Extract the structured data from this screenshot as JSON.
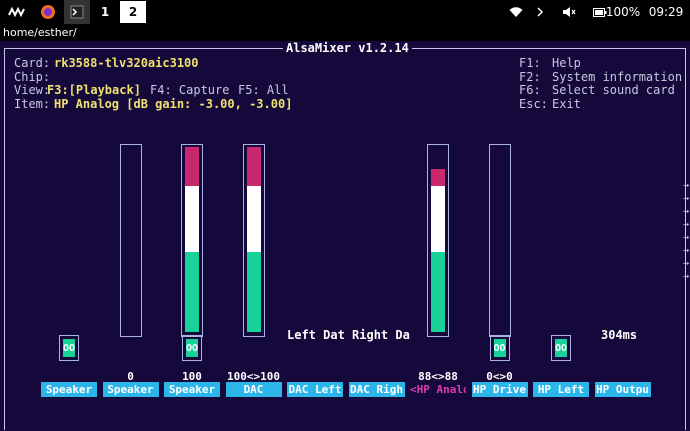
{
  "topbar": {
    "workspaces": [
      "1",
      "2"
    ],
    "battery": "100%",
    "clock": "09:29"
  },
  "path": "home/esther/",
  "mixer": {
    "title": "AlsaMixer v1.2.14",
    "card_label": "Card:",
    "card_value": "rk3588-tlv320aic3100",
    "chip_label": "Chip:",
    "view_label": "View:",
    "view_f3": "F3:[Playback]",
    "view_f4": "F4: Capture",
    "view_f5": "F5: All",
    "item_label": "Item:",
    "item_value": "HP Analog [dB gain: -3.00, -3.00]",
    "help": [
      {
        "key": "F1:",
        "text": "Help"
      },
      {
        "key": "F2:",
        "text": "System information"
      },
      {
        "key": "F6:",
        "text": "Select sound card"
      },
      {
        "key": "Esc:",
        "text": "Exit"
      }
    ],
    "enum_label": "Left Dat Right Da",
    "latency": "304ms",
    "mute_label": "OO",
    "channels": [
      {
        "name": "Speaker",
        "value": "",
        "level": null,
        "mute": true
      },
      {
        "name": "Speaker",
        "value": "0",
        "level": 0,
        "mute": false
      },
      {
        "name": "Speaker",
        "value": "100",
        "level": 100,
        "mute": true
      },
      {
        "name": "DAC",
        "value": "100<>100",
        "level": 100,
        "mute": false
      },
      {
        "name": "DAC Left",
        "value": "",
        "level": null,
        "mute": false
      },
      {
        "name": "DAC Righ",
        "value": "",
        "level": null,
        "mute": false
      },
      {
        "name": "<HP Analo>",
        "value": "88<>88",
        "level": 88,
        "mute": false,
        "selected": true
      },
      {
        "name": "HP Drive",
        "value": "0<>0",
        "level": 0,
        "mute": true
      },
      {
        "name": "HP Left",
        "value": "",
        "level": null,
        "mute": true
      },
      {
        "name": "HP Outpu",
        "value": "",
        "level": null,
        "mute": false
      }
    ]
  },
  "colors": {
    "background": "#14093a",
    "accent": "#2bb5e8",
    "green": "#19d29a",
    "red": "#c8286e",
    "selected": "#e03ab0"
  }
}
